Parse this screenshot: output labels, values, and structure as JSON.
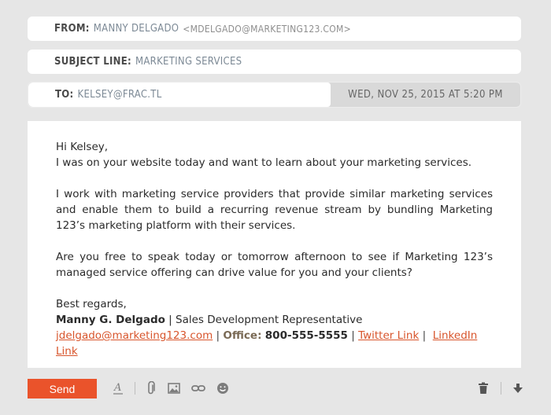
{
  "header": {
    "from_label": "From:",
    "from_name": "Manny Delgado",
    "from_email": "<mdelgado@marketing123.com>",
    "subject_label": "Subject Line:",
    "subject_value": "Marketing Services",
    "to_label": "To:",
    "to_value": "kelsey@frac.tl",
    "date": "Wed, Nov 25, 2015 at 5:20 PM"
  },
  "body": {
    "greeting": "Hi Kelsey,",
    "line1": "I was on your website today and want to learn about your marketing services.",
    "para2": "I work with marketing service providers that provide similar marketing services and enable them to build a recurring revenue stream by bundling Marketing 123’s marketing platform with their services.",
    "para3": "Are you free to speak today or tomorrow afternoon to see if Marketing 123’s managed service offering can drive value for you and your clients?",
    "closing": "Best regards,",
    "sig_name": "Manny G. Delgado",
    "sig_title": " | Sales Development Representative",
    "sig_email": "jdelgado@marketing123.com",
    "sig_office_label": "Office:",
    "sig_office_number": "800-555-5555",
    "sig_twitter": "Twitter Link",
    "sig_linkedin": "LinkedIn Link"
  },
  "toolbar": {
    "send_label": "Send",
    "icons": [
      "format-text-icon",
      "attach-icon",
      "image-icon",
      "link-icon",
      "emoji-icon",
      "trash-icon",
      "more-options-icon"
    ]
  },
  "colors": {
    "accent": "#ea532b",
    "link": "#d8552c",
    "background": "#e6e6e6"
  }
}
